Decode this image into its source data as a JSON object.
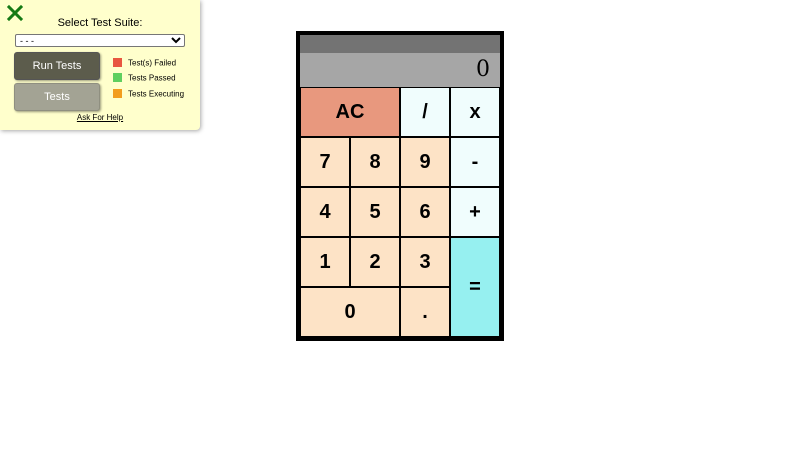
{
  "test_panel": {
    "title": "Select Test Suite:",
    "suite_select": {
      "selected": "- - -",
      "options": [
        "- - -"
      ]
    },
    "run_tests_label": "Run Tests",
    "tests_label": "Tests",
    "legend": [
      {
        "label": "Test(s) Failed",
        "color": "#e8563f"
      },
      {
        "label": "Tests Passed",
        "color": "#5fcf5f"
      },
      {
        "label": "Tests Executing",
        "color": "#f29d1e"
      }
    ],
    "help_link": "Ask For Help",
    "close_icon_color": "#157a15"
  },
  "calculator": {
    "display": "0",
    "keys": {
      "clear": "AC",
      "divide": "/",
      "multiply": "x",
      "subtract": "-",
      "add": "+",
      "equals": "=",
      "decimal": ".",
      "seven": "7",
      "eight": "8",
      "nine": "9",
      "four": "4",
      "five": "5",
      "six": "6",
      "one": "1",
      "two": "2",
      "three": "3",
      "zero": "0"
    },
    "colors": {
      "number_key": "#fde3c6",
      "operator_key": "#f0fdfd",
      "equals_key": "#96f0f0",
      "clear_key": "#e8987e",
      "display": "#a6a6a6",
      "display_header": "#737373"
    }
  }
}
